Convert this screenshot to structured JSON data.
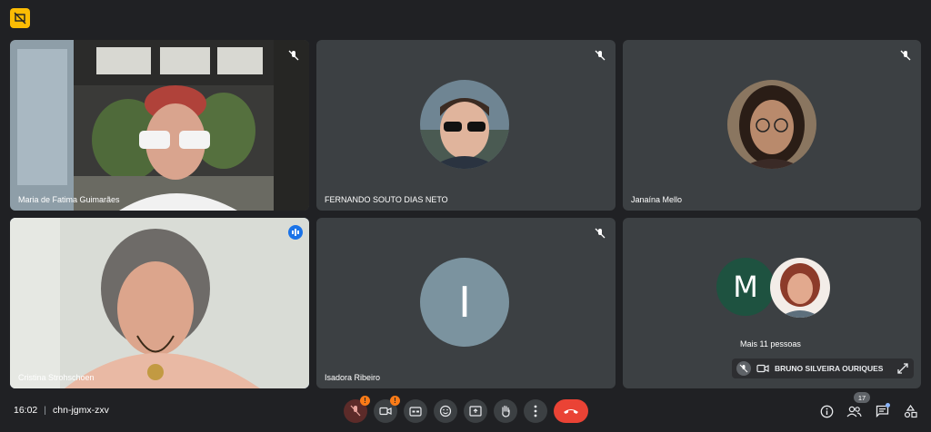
{
  "meeting": {
    "time": "16:02",
    "separator": "|",
    "code": "chn-jgmx-zxv"
  },
  "tiles": [
    {
      "name": "Maria de Fatima Guimarães"
    },
    {
      "name": "FERNANDO SOUTO DIAS NETO"
    },
    {
      "name": "Janaína Mello"
    },
    {
      "name": "Cristina Strohschoen"
    },
    {
      "name": "Isadora Ribeiro",
      "avatar_letter": "I"
    }
  ],
  "others": {
    "avatar_letter": "M",
    "label": "Mais 11 pessoas"
  },
  "pinned": {
    "label": "BRUNO SILVEIRA OURIQUES"
  },
  "controls": {
    "warn_mark": "!",
    "participants_count": "17"
  },
  "colors": {
    "tile_bg": "#3c4043",
    "end_call": "#ea4335",
    "accent": "#1a73e8",
    "warning": "#fa7b17"
  }
}
